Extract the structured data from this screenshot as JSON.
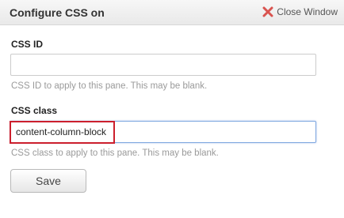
{
  "window": {
    "title": "Configure CSS on",
    "close_label": "Close Window",
    "close_icon": "close-x-icon",
    "close_icon_color": "#d9534f"
  },
  "form": {
    "css_id": {
      "label": "CSS ID",
      "value": "",
      "help": "CSS ID to apply to this pane. This may be blank."
    },
    "css_class": {
      "label": "CSS class",
      "value": "content-column-block",
      "help": "CSS class to apply to this pane. This may be blank."
    },
    "save_label": "Save"
  },
  "colors": {
    "highlight": "#cc1f2d",
    "focus_border": "#7fa8e0"
  }
}
